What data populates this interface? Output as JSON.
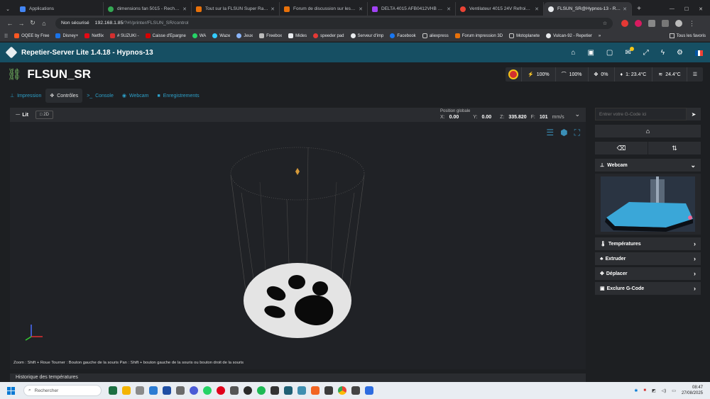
{
  "browser": {
    "tabs": [
      {
        "label": "Applications",
        "color": "#4285f4"
      },
      {
        "label": "dimensions fan 5015 - Recherch",
        "color": "#34a853"
      },
      {
        "label": "Tout sur la FLSUN Super Racer",
        "color": "#e8710a"
      },
      {
        "label": "Forum de discussion sur les imp",
        "color": "#e8710a"
      },
      {
        "label": "DELTA 4015 AFB0412VHB 12V",
        "color": "#a142f4"
      },
      {
        "label": "Ventilateur 4015 24V Refroidiss",
        "color": "#ea4335"
      },
      {
        "label": "FLSUN_SR@Hypnos-13 - Repetier",
        "color": "#e8eaed"
      }
    ],
    "new_tab": "+",
    "not_secure": "Non sécurisé",
    "url_host": "192.168.1.85",
    "url_path": "/?#!/printer/FLSUN_SR/control",
    "bookmarks": [
      "OQEE by Free",
      "Disney+",
      "Netflix",
      "# SUZUKI -",
      "Caisse d'Epargne",
      "WA",
      "Waze",
      "Jeux",
      "Freebox",
      "Mides",
      "speeder pad",
      "Serveur d'imp",
      "Facebook",
      "aliexpress",
      "Forum impression 3D",
      "Motoplanete",
      "Vulcan-92 - Repetier"
    ],
    "bookmark_more": "»",
    "all_bookmarks": "Tous les favoris"
  },
  "app": {
    "title": "Repetier-Server Lite 1.4.18 - Hypnos-13",
    "printer_name": "FLSUN_SR",
    "stats": {
      "fan": "100%",
      "speed": "100%",
      "flow": "0%",
      "extruder_temp": "1: 23.4°C",
      "bed_temp": "24.4°C"
    },
    "tabs": [
      "Impression",
      "Contrôles",
      "Console",
      "Webcam",
      "Enregistrements"
    ],
    "active_tab": "Contrôles",
    "view": {
      "lit_label": "Lit",
      "mode_2d": "2D",
      "position_label": "Position globale",
      "x_label": "X:",
      "x_value": "0.00",
      "y_label": "Y:",
      "y_value": "0.00",
      "z_label": "Z:",
      "z_value": "335.820",
      "f_label": "F:",
      "f_value": "101",
      "f_unit": "mm/s",
      "help_text": "Zoom : Shift + Roue Tourner : Bouton gauche de la souris Pan : Shift + bouton gauche de la souris ou bouton droit de la souris"
    },
    "history_label": "Historique des températures",
    "gcode_placeholder": "Entrer votre G-Code ici",
    "panels": {
      "webcam": "Webcam",
      "temperatures": "Températures",
      "extruder": "Extruder",
      "deplacer": "Déplacer",
      "exclure": "Exclure G-Code"
    }
  },
  "taskbar": {
    "search_placeholder": "Rechercher",
    "time": "08:47",
    "date": "27/08/2025"
  },
  "colors": {
    "accent": "#2da0c9",
    "navbar": "#164f63"
  }
}
